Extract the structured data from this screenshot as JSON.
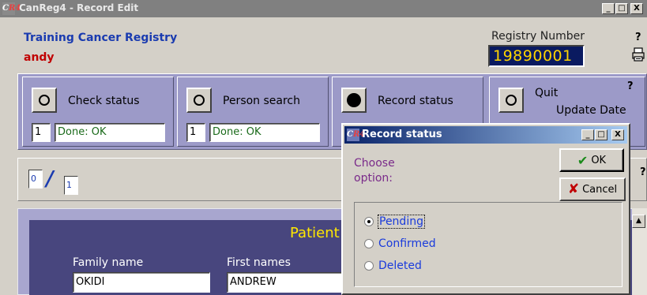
{
  "window": {
    "title": "CanReg4 - Record Edit",
    "min_label": "_",
    "max_label": "□",
    "close_label": "X",
    "help_label": "?"
  },
  "header": {
    "registry_name": "Training Cancer Registry",
    "user": "andy",
    "registry_number_label": "Registry Number",
    "registry_number": "19890001"
  },
  "actions": [
    {
      "label": "Check status",
      "count": "1",
      "status": "Done: OK",
      "selected": false
    },
    {
      "label": "Person search",
      "count": "1",
      "status": "Done: OK",
      "selected": false
    },
    {
      "label": "Record status",
      "selected": true
    },
    {
      "label": "Quit",
      "extra_label": "Update Date",
      "selected": false
    }
  ],
  "navigation": {
    "current": "0",
    "total": "1"
  },
  "patient_form": {
    "title": "Patient",
    "family_name_label": "Family name",
    "family_name": "OKIDI",
    "first_names_label": "First names",
    "first_names": "ANDREW"
  },
  "dialog": {
    "title": "Record status",
    "prompt_line1": "Choose",
    "prompt_line2": "option:",
    "ok_label": "OK",
    "cancel_label": "Cancel",
    "options": [
      "Pending",
      "Confirmed",
      "Deleted"
    ],
    "selected_option": "Pending"
  },
  "colors": {
    "action_panel": "#9c9ac8",
    "form_background": "#48467e",
    "registry_number_text": "#ffd400",
    "dialog_title_gradient_start": "#0a246a"
  }
}
